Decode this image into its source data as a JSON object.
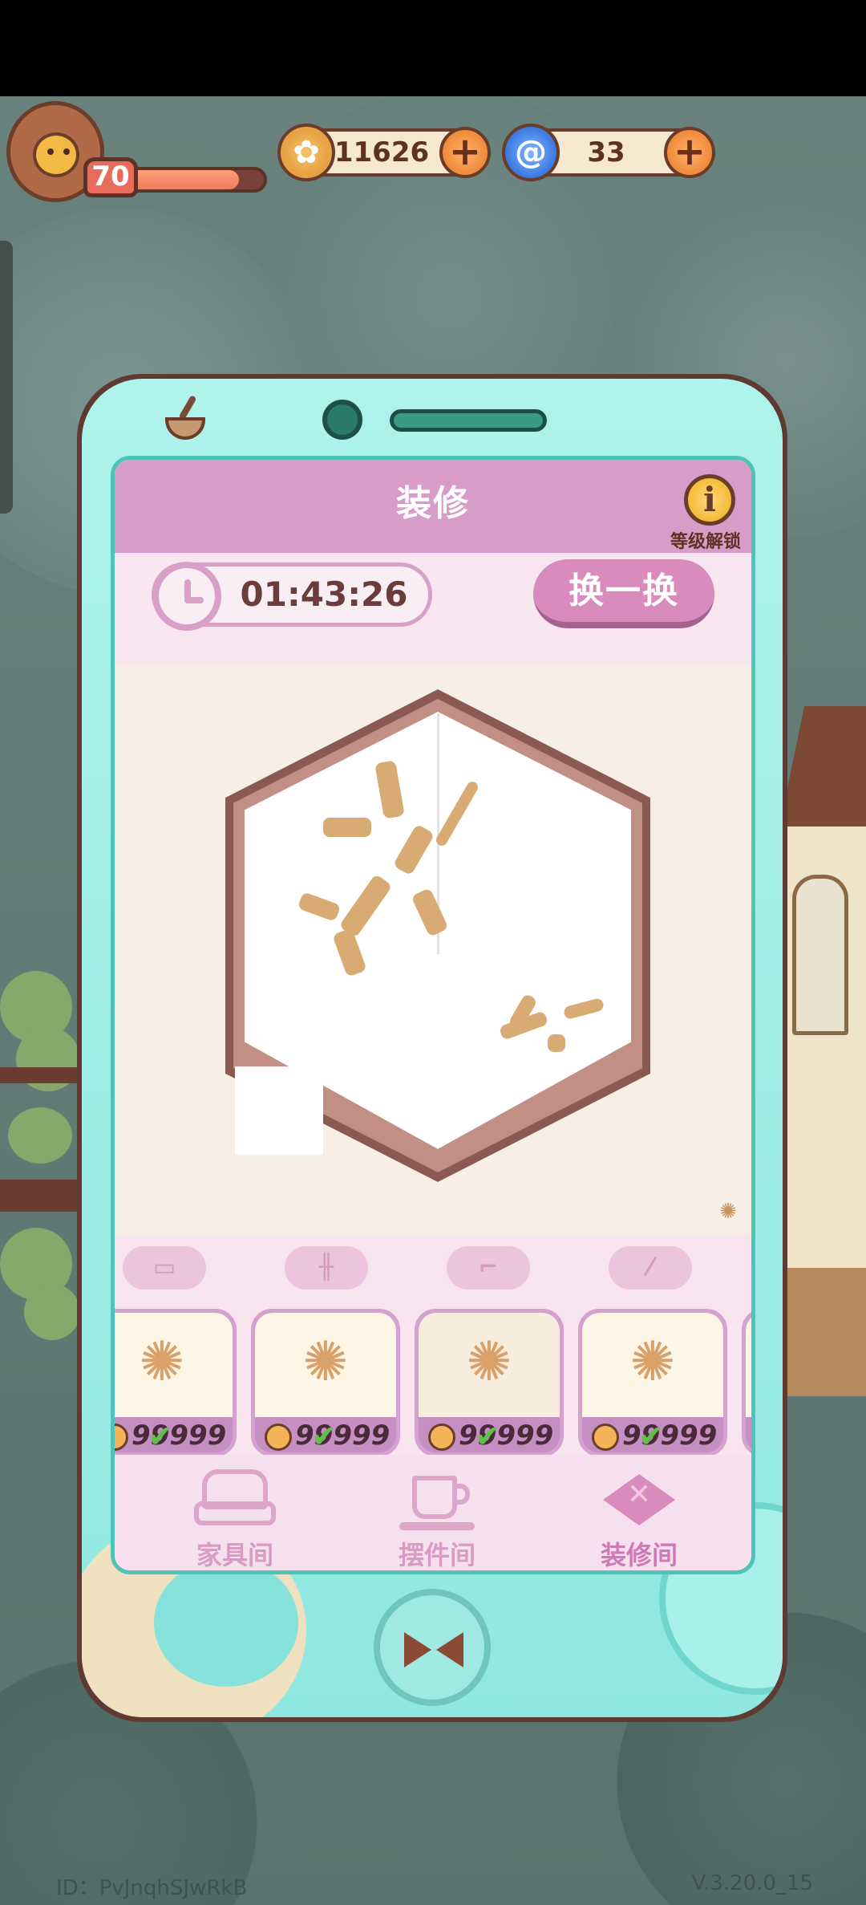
{
  "hud": {
    "level": "70",
    "xp_fraction": 0.82,
    "coins": "11626",
    "gems": "33",
    "plus_symbol": "+"
  },
  "panel": {
    "title": "装修",
    "info_symbol": "i",
    "info_label": "等级解锁",
    "timer": "01:43:26",
    "swap_button": "换一换"
  },
  "category_tabs": [
    {
      "icon": "window-icon",
      "glyph": "▭"
    },
    {
      "icon": "fence-icon",
      "glyph": "╫"
    },
    {
      "icon": "stairs-icon",
      "glyph": "⌐"
    },
    {
      "icon": "railing-icon",
      "glyph": "⁄"
    }
  ],
  "items": [
    {
      "price": "99999"
    },
    {
      "price": "99999"
    },
    {
      "price": "99999"
    },
    {
      "price": "99999"
    }
  ],
  "nav": {
    "furniture": "家具间",
    "decor": "摆件间",
    "renovation": "装修间",
    "active": "renovation"
  },
  "footer": {
    "id": "ID：PvJnqhSJwRkB",
    "version": "V.3.20.0_15"
  },
  "colors": {
    "accent_pink": "#d98bbd",
    "phone_teal": "#aef3ec",
    "check_green": "#5fc14a"
  }
}
